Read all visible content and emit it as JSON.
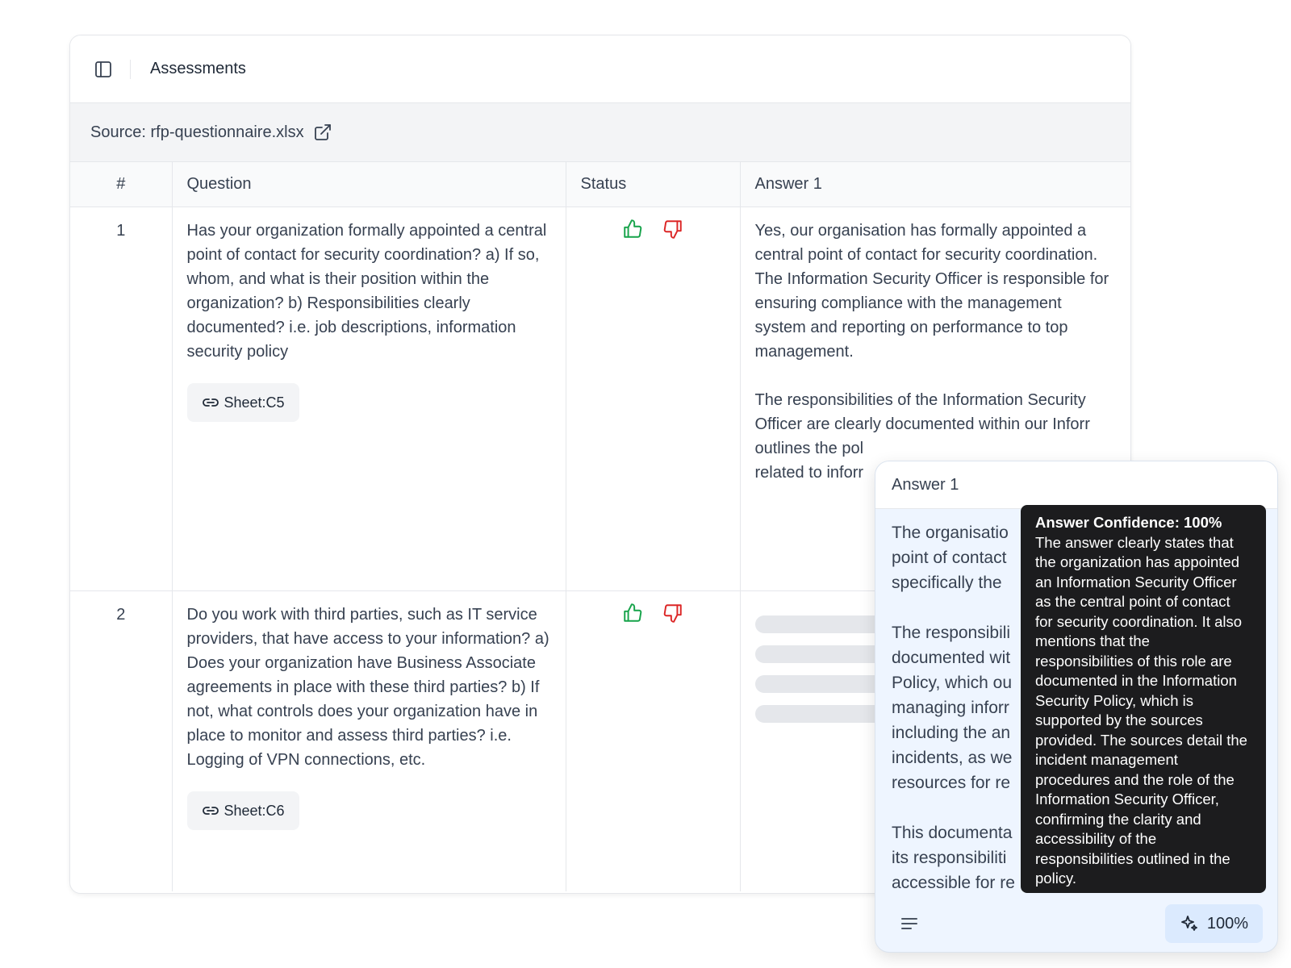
{
  "header": {
    "title": "Assessments"
  },
  "source": {
    "label": "Source: rfp-questionnaire.xlsx"
  },
  "table": {
    "columns": [
      "#",
      "Question",
      "Status",
      "Answer 1"
    ],
    "rows": [
      {
        "num": "1",
        "question": "Has your organization formally appointed a central point of contact for security coordination? a) If so, whom, and what is their position within the organization? b) Responsibilities clearly documented? i.e. job descriptions, information security policy",
        "sheet": "Sheet:C5",
        "answer": "Yes, our organisation has formally appointed a central point of contact for security coordination. The Information Security Officer is responsible for ensuring compliance with the management system and reporting on performance to top management.\n\nThe responsibilities of the Information Security Officer are clearly documented within our Inforr\noutlines the pol\nrelated to inforr"
      },
      {
        "num": "2",
        "question": "Do you work with third parties, such as IT service providers, that have access to your information? a) Does your organization have Business Associate agreements in place with these third parties? b) If not, what controls does your organization have in place to monitor and assess third parties? i.e. Logging of VPN connections, etc.",
        "sheet": "Sheet:C6",
        "answer": ""
      }
    ]
  },
  "panel": {
    "title": "Answer 1",
    "body": "The organisatio\npoint of contact\nspecifically the\n\nThe responsibili\ndocumented wit\nPolicy, which ou\nmanaging inforr\nincluding the an\nincidents, as we\nresources for re\n\nThis documenta\nits responsibiliti\naccessible for re",
    "confidence": "100%"
  },
  "tooltip": {
    "title": "Answer Confidence: 100%",
    "body": "The answer clearly states that the organization has appointed an Information Security Officer as the central point of contact for security coordination. It also mentions that the responsibilities of this role are documented in the Information Security Policy, which is supported by the sources provided. The sources detail the incident management procedures and the role of the Information Security Officer, confirming the clarity and accessibility of the responsibilities outlined in the policy."
  },
  "colors": {
    "thumb_up": "#16a34a",
    "thumb_down": "#dc2626",
    "tooltip_bg": "#1c1c1e",
    "panel_bg": "#eef5ff"
  }
}
